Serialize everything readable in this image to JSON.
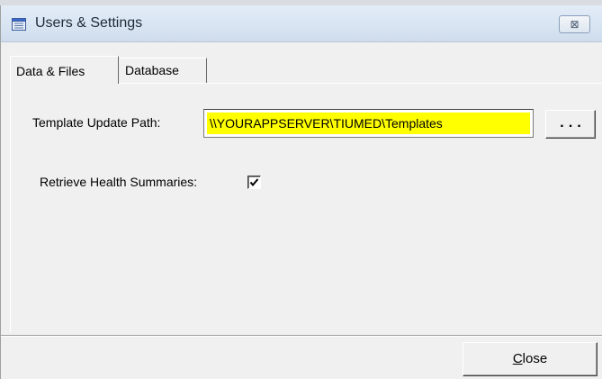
{
  "window": {
    "title": "Users & Settings",
    "close_glyph": "⊠",
    "icon": "app-icon"
  },
  "tabs": [
    {
      "label": "Data & Files",
      "active": true
    },
    {
      "label": "Database",
      "active": false
    }
  ],
  "template_path": {
    "label": "Template Update Path:",
    "value": "\\\\YOURAPPSERVER\\TIUMED\\Templates",
    "highlight_color": "#ffff00"
  },
  "browse_button": {
    "label": "..."
  },
  "health_summaries": {
    "label": "Retrieve Health Summaries:",
    "checked": true
  },
  "footer": {
    "close_mnemonic": "C",
    "close_rest": "lose"
  }
}
